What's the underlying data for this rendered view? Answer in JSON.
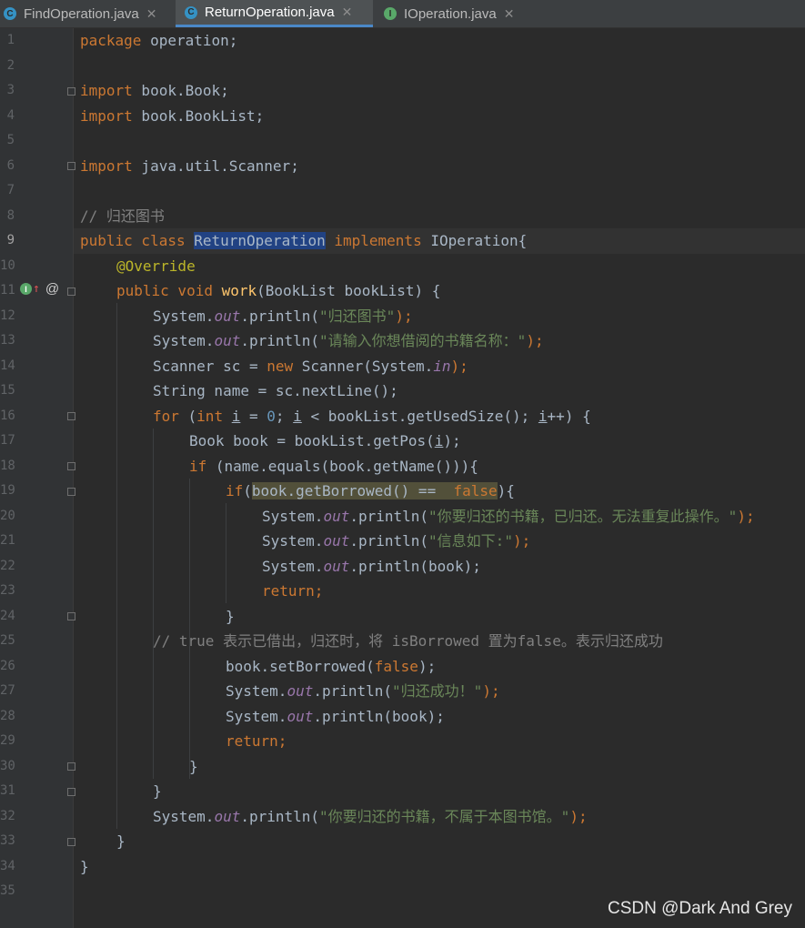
{
  "tabs": [
    {
      "label": "FindOperation.java",
      "icon": "C",
      "icon_color": "#3592c4",
      "active": false
    },
    {
      "label": "ReturnOperation.java",
      "icon": "C",
      "icon_color": "#3592c4",
      "active": true
    },
    {
      "label": "IOperation.java",
      "icon": "I",
      "icon_color": "#59a869",
      "active": false
    }
  ],
  "tab_close_glyph": "✕",
  "line_numbers": [
    "1",
    "2",
    "3",
    "4",
    "5",
    "6",
    "7",
    "8",
    "9",
    "10",
    "11",
    "12",
    "13",
    "14",
    "15",
    "16",
    "17",
    "18",
    "19",
    "20",
    "21",
    "22",
    "23",
    "24",
    "25",
    "26",
    "27",
    "28",
    "29",
    "30",
    "31",
    "32",
    "33",
    "34",
    "35"
  ],
  "code": {
    "l1_kw": "package",
    "l1_rest": " operation;",
    "l3_kw": "import",
    "l3_rest": " book.Book;",
    "l4_kw": "import",
    "l4_rest": " book.BookList;",
    "l6_kw": "import",
    "l6_rest": " java.util.Scanner;",
    "l8_cmt": "// 归还图书",
    "l9_kw1": "public class ",
    "l9_sel": "ReturnOperation",
    "l9_kw2": " implements",
    "l9_rest": " IOperation{",
    "l10_ann": "@Override",
    "l11_kw": "public void ",
    "l11_fn": "work",
    "l11_rest": "(BookList bookList) {",
    "l12_a": "System.",
    "l12_fld": "out",
    "l12_b": ".println(",
    "l12_str": "\"归还图书\"",
    "l12_c": ");",
    "l13_a": "System.",
    "l13_fld": "out",
    "l13_b": ".println(",
    "l13_str": "\"请输入你想借阅的书籍名称：\"",
    "l13_c": ");",
    "l14_a": "Scanner sc = ",
    "l14_kw": "new",
    "l14_b": " Scanner(System.",
    "l14_fld": "in",
    "l14_c": ");",
    "l15": "String name = sc.nextLine();",
    "l16_kw1": "for",
    "l16_a": " (",
    "l16_kw2": "int",
    "l16_b": " ",
    "l16_i1": "i",
    "l16_c": " = ",
    "l16_num": "0",
    "l16_d": "; ",
    "l16_i2": "i",
    "l16_e": " < bookList.getUsedSize(); ",
    "l16_i3": "i",
    "l16_f": "++) {",
    "l17_a": "Book book = bookList.getPos(",
    "l17_i": "i",
    "l17_b": ");",
    "l18_kw": "if",
    "l18_rest": " (name.equals(book.getName())){",
    "l19_kw": "if",
    "l19_a": "(",
    "l19_hl": "book.getBorrowed() ==  ",
    "l19_kwf": "false",
    "l19_b": "){",
    "l20_a": "System.",
    "l20_fld": "out",
    "l20_b": ".println(",
    "l20_str": "\"你要归还的书籍，已归还。无法重复此操作。\"",
    "l20_c": ");",
    "l21_a": "System.",
    "l21_fld": "out",
    "l21_b": ".println(",
    "l21_str": "\"信息如下:\"",
    "l21_c": ");",
    "l22_a": "System.",
    "l22_fld": "out",
    "l22_b": ".println(book);",
    "l23_kw": "return",
    "l23_c": ";",
    "l24": "}",
    "l25_cmt": "// true 表示已借出，归还时，将 isBorrowed 置为false。表示归还成功",
    "l26_a": "book.setBorrowed(",
    "l26_kw": "false",
    "l26_b": ");",
    "l27_a": "System.",
    "l27_fld": "out",
    "l27_b": ".println(",
    "l27_str": "\"归还成功！\"",
    "l27_c": ");",
    "l28_a": "System.",
    "l28_fld": "out",
    "l28_b": ".println(book);",
    "l29_kw": "return",
    "l29_c": ";",
    "l30": "}",
    "l31": "}",
    "l32_a": "System.",
    "l32_fld": "out",
    "l32_b": ".println(",
    "l32_str": "\"你要归还的书籍，不属于本图书馆。\"",
    "l32_c": ");",
    "l33": "}",
    "l34": "}"
  },
  "gutter": {
    "implements_icon": "I",
    "override_arrow": "↑",
    "at_glyph": "@"
  },
  "watermark": "CSDN @Dark And Grey",
  "colors": {
    "background": "#2b2b2b",
    "keyword": "#cc7832",
    "string": "#6a8759",
    "comment": "#808080",
    "annotation": "#bbb529",
    "selection": "#214283"
  }
}
